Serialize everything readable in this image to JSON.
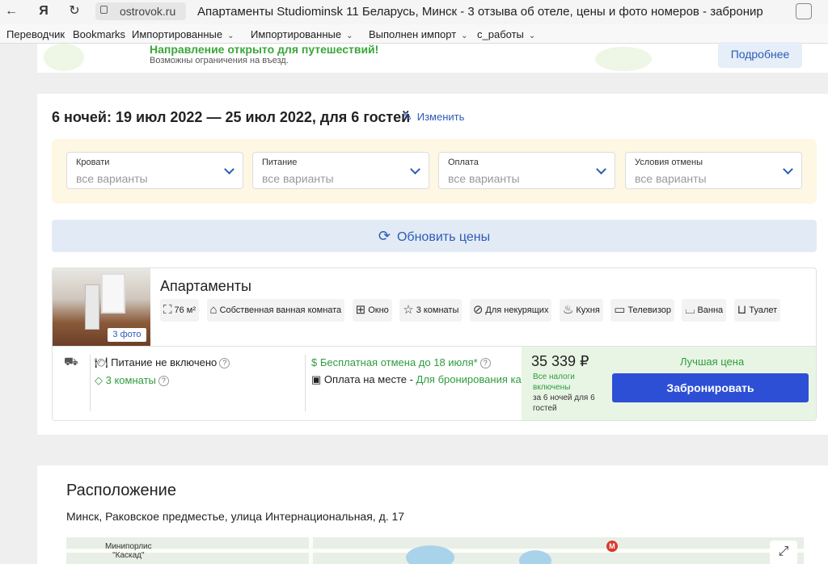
{
  "browser": {
    "url": "ostrovok.ru",
    "title": "Апартаменты Studiominsk 11 Беларусь, Минск - 3 отзыва об отеле, цены и фото номеров - заброниро...",
    "bookmarks": [
      "Переводчик",
      "Bookmarks",
      "Импортированные",
      "Импортированные",
      "Выполнен импорт",
      "с_работы"
    ]
  },
  "banner": {
    "title": "Направление открыто для путешествий!",
    "subtitle": "Возможны ограничения на въезд.",
    "more_label": "Подробнее"
  },
  "booking": {
    "dates": "6 ночей: 19 июл 2022 — 25 июл 2022, для 6 гостей",
    "edit_label": "Изменить",
    "filters": [
      {
        "label": "Кровати",
        "value": "все варианты"
      },
      {
        "label": "Питание",
        "value": "все варианты"
      },
      {
        "label": "Оплата",
        "value": "все варианты"
      },
      {
        "label": "Условия отмены",
        "value": "все варианты"
      }
    ],
    "refresh_label": "Обновить цены"
  },
  "room": {
    "name": "Апартаменты",
    "photo_count": "3 фото",
    "amenities": [
      {
        "icon": "area-icon",
        "glyph": "⛶",
        "label": "76 м²"
      },
      {
        "icon": "bath-icon",
        "glyph": "🛁",
        "label": "Собственная ванная комната"
      },
      {
        "icon": "window-icon",
        "glyph": "⊞",
        "label": "Окно"
      },
      {
        "icon": "star-icon",
        "glyph": "☆",
        "label": "3 комнаты"
      },
      {
        "icon": "no-smoking-icon",
        "glyph": "⊘",
        "label": "Для некурящих"
      },
      {
        "icon": "chef-hat-icon",
        "glyph": "♨",
        "label": "Кухня"
      },
      {
        "icon": "tv-icon",
        "glyph": "▭",
        "label": "Телевизор"
      },
      {
        "icon": "bathtub-icon",
        "glyph": "⌴",
        "label": "Ванна"
      },
      {
        "icon": "toilet-icon",
        "glyph": "⊔",
        "label": "Туалет"
      }
    ],
    "meal": "Питание не включено",
    "rooms": "3 комнаты",
    "cancel": "Бесплатная отмена до 18 июля*",
    "payment_prefix": "Оплата на месте - ",
    "payment_card": "Для бронирования карта не нужна!",
    "price": "35 339 ₽",
    "taxes": "Все налоги включены",
    "nights": "за 6 ночей для 6 гостей",
    "best_price": "Лучшая цена",
    "book_label": "Забронировать"
  },
  "location": {
    "title": "Расположение",
    "address": "Минск, Раковское предместье, улица Интернациональная, д. 17",
    "map_label_1": "Минипорлис",
    "map_label_2": "\"Каскад\"",
    "metro": "М"
  }
}
